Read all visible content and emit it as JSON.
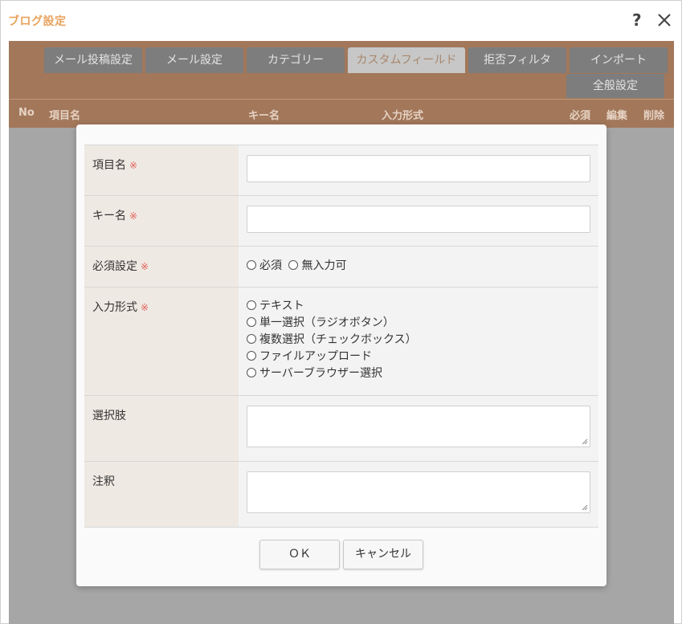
{
  "window": {
    "title": "ブログ設定",
    "help_icon": "?"
  },
  "tabs": [
    {
      "label": "メール投稿設定",
      "active": false
    },
    {
      "label": "メール設定",
      "active": false
    },
    {
      "label": "カテゴリー",
      "active": false
    },
    {
      "label": "カスタムフィールド",
      "active": true
    },
    {
      "label": "拒否フィルタ",
      "active": false
    },
    {
      "label": "インポート",
      "active": false
    },
    {
      "label": "全般設定",
      "active": false
    }
  ],
  "columns": {
    "no": "No",
    "item_name": "項目名",
    "key_name": "キー名",
    "input_type": "入力形式",
    "required": "必須",
    "edit": "編集",
    "delete": "削除"
  },
  "form": {
    "required_mark": "※",
    "item_name": {
      "label": "項目名",
      "value": ""
    },
    "key_name": {
      "label": "キー名",
      "value": ""
    },
    "required_setting": {
      "label": "必須設定",
      "options": [
        "必須",
        "無入力可"
      ]
    },
    "input_type": {
      "label": "入力形式",
      "options": [
        "テキスト",
        "単一選択（ラジオボタン）",
        "複数選択（チェックボックス）",
        "ファイルアップロード",
        "サーバーブラウザー選択"
      ]
    },
    "choices": {
      "label": "選択肢",
      "value": ""
    },
    "note": {
      "label": "注釈",
      "value": ""
    }
  },
  "buttons": {
    "ok": "ＯＫ",
    "cancel": "キャンセル"
  },
  "colors": {
    "title": "#e8a25d",
    "tabbar": "#a2775a",
    "tab": "#7d7d7d",
    "tab_active": "#c7c7c7",
    "required_mark": "#e0625a",
    "label_bg": "#efe9e3"
  }
}
